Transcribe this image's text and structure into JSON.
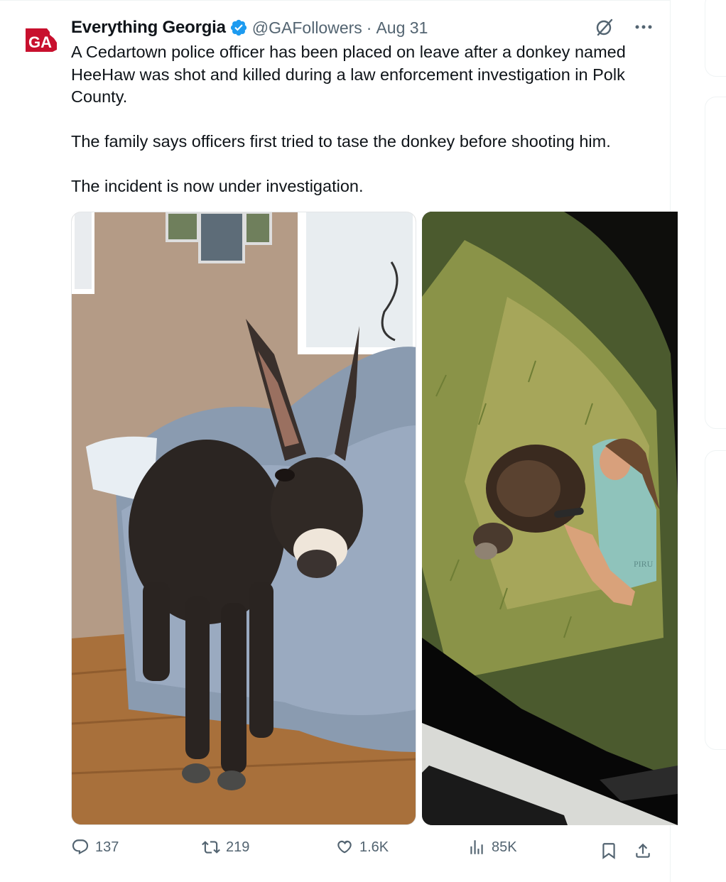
{
  "tweet": {
    "display_name": "Everything Georgia",
    "handle": "@GAFollowers",
    "separator": "·",
    "date": "Aug 31",
    "text": "A Cedartown police officer has been placed on leave after a donkey named HeeHaw was shot and killed during a law enforcement investigation in Polk County.\n\nThe family says officers first tried to tase the donkey before shooting him.\n\nThe incident is now under investigation.",
    "avatar_logo": "GA",
    "shirt_text": "PIRU"
  },
  "actions": {
    "replies": "137",
    "reposts": "219",
    "likes": "1.6K",
    "views": "85K"
  },
  "icons": {
    "verified": "verified-badge-icon",
    "grok": "grok-icon",
    "more": "more-icon",
    "reply": "reply-icon",
    "repost": "repost-icon",
    "like": "heart-icon",
    "views": "views-icon",
    "bookmark": "bookmark-icon",
    "share": "share-icon"
  },
  "colors": {
    "accent": "#1d9bf0",
    "muted": "#536471",
    "logo_red": "#c8102e"
  }
}
